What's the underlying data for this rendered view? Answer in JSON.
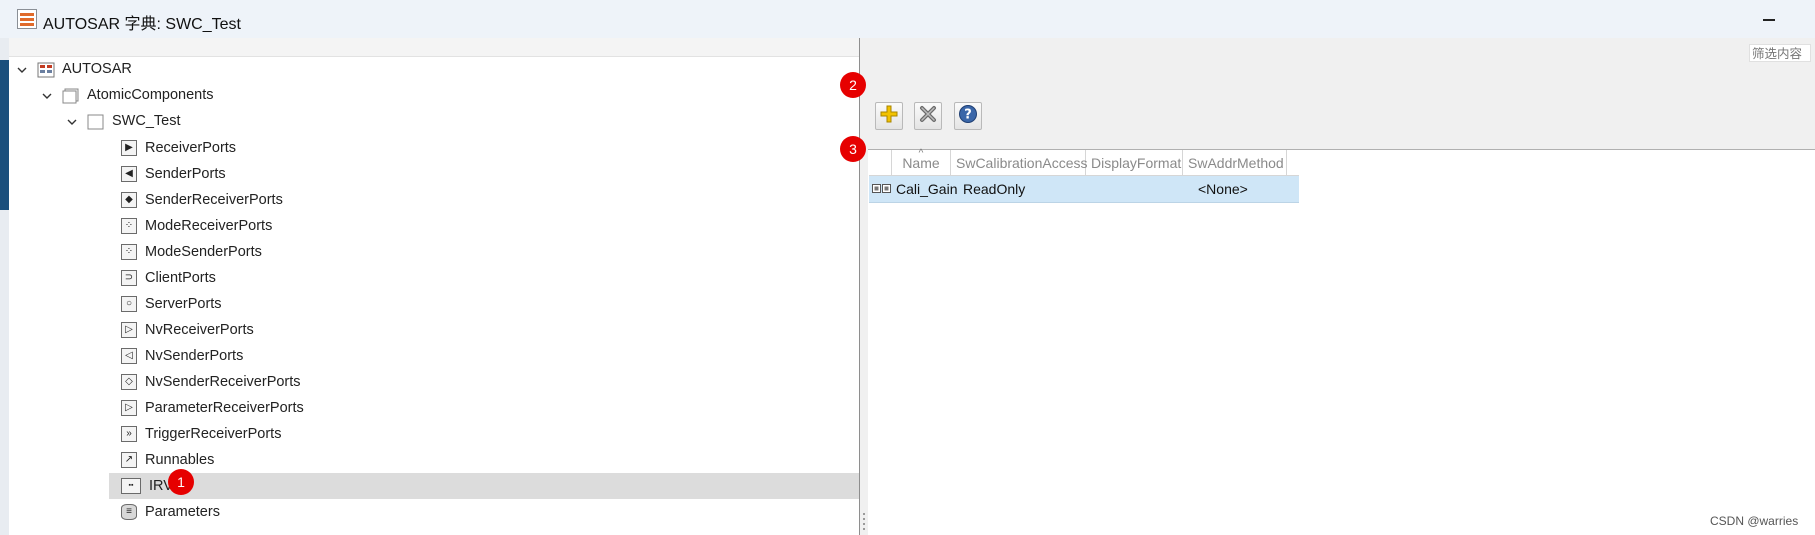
{
  "window": {
    "title": "AUTOSAR 字典: SWC_Test"
  },
  "tree": {
    "root": "AUTOSAR",
    "atomic": "AtomicComponents",
    "component": "SWC_Test",
    "items": [
      {
        "label": "ReceiverPorts",
        "icon": "receiver-port-icon",
        "glyph": "▶"
      },
      {
        "label": "SenderPorts",
        "icon": "sender-port-icon",
        "glyph": "◀"
      },
      {
        "label": "SenderReceiverPorts",
        "icon": "sender-receiver-port-icon",
        "glyph": "◆"
      },
      {
        "label": "ModeReceiverPorts",
        "icon": "mode-receiver-port-icon",
        "glyph": "⁘"
      },
      {
        "label": "ModeSenderPorts",
        "icon": "mode-sender-port-icon",
        "glyph": "⁘"
      },
      {
        "label": "ClientPorts",
        "icon": "client-port-icon",
        "glyph": "⊃"
      },
      {
        "label": "ServerPorts",
        "icon": "server-port-icon",
        "glyph": "○"
      },
      {
        "label": "NvReceiverPorts",
        "icon": "nv-receiver-port-icon",
        "glyph": "▷"
      },
      {
        "label": "NvSenderPorts",
        "icon": "nv-sender-port-icon",
        "glyph": "◁"
      },
      {
        "label": "NvSenderReceiverPorts",
        "icon": "nv-sender-receiver-port-icon",
        "glyph": "◇"
      },
      {
        "label": "ParameterReceiverPorts",
        "icon": "parameter-receiver-port-icon",
        "glyph": "▷"
      },
      {
        "label": "TriggerReceiverPorts",
        "icon": "trigger-receiver-port-icon",
        "glyph": "»"
      },
      {
        "label": "Runnables",
        "icon": "runnables-icon",
        "glyph": "↗"
      },
      {
        "label": "IRV",
        "icon": "irv-icon",
        "glyph": "▪▪"
      },
      {
        "label": "Parameters",
        "icon": "parameters-icon",
        "glyph": "≡"
      }
    ],
    "selected": "IRV"
  },
  "filter": {
    "placeholder": "筛选内容"
  },
  "toolbar": {
    "add": "add",
    "delete": "delete",
    "help": "help"
  },
  "badges": {
    "one": "1",
    "two": "2",
    "three": "3"
  },
  "grid": {
    "columns": [
      "Name",
      "SwCalibrationAccess",
      "DisplayFormat",
      "SwAddrMethod"
    ],
    "rows": [
      {
        "name": "Cali_Gain",
        "access": "ReadOnly",
        "format": "",
        "addr": "<None>"
      }
    ]
  },
  "watermark": "CSDN @warries",
  "colors": {
    "accent": "#e60000",
    "selection": "#cfe6f7",
    "tree_selected": "#dcdcdc"
  }
}
